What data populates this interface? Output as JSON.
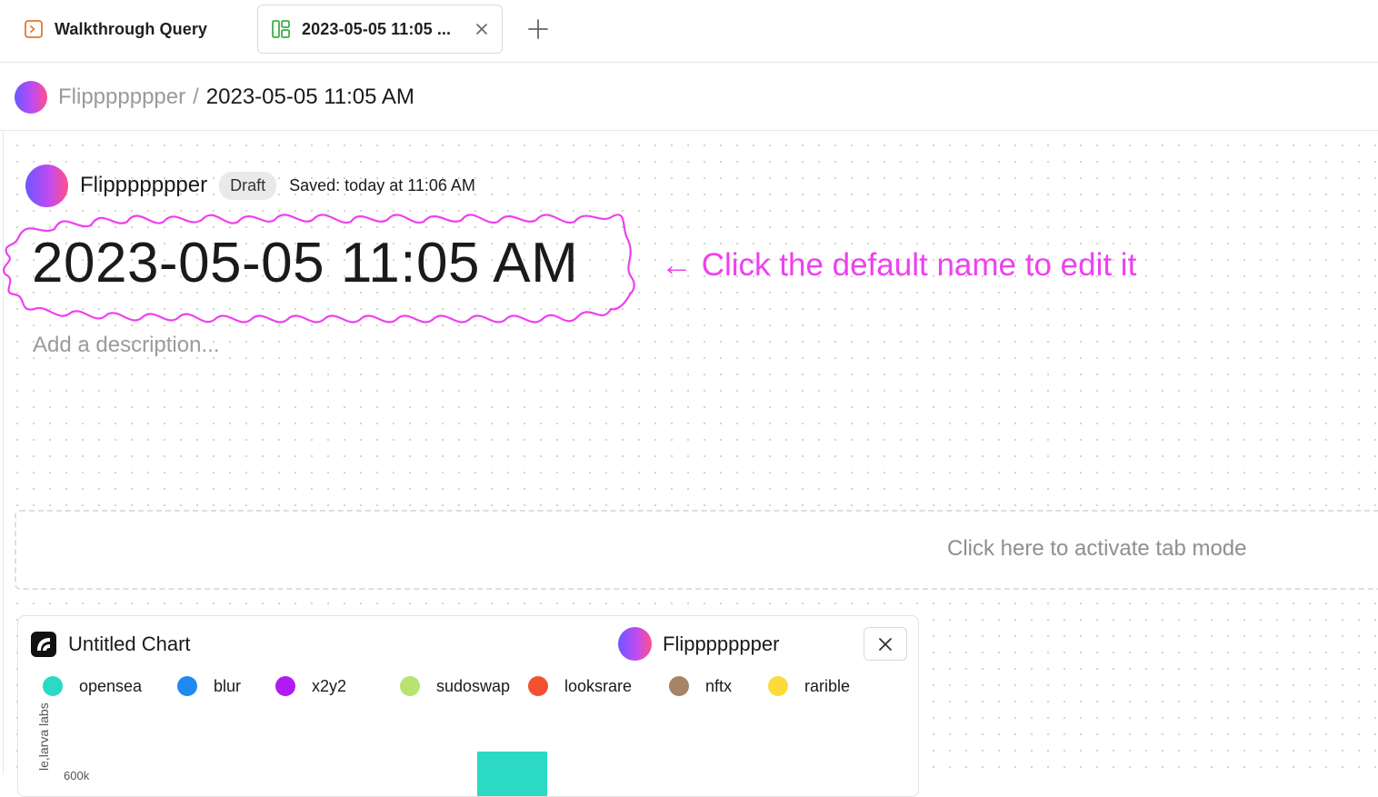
{
  "tabs": [
    {
      "label": "Walkthrough Query",
      "icon": "query-icon"
    },
    {
      "label": "2023-05-05 11:05 ...",
      "icon": "dashboard-icon",
      "active": true
    }
  ],
  "breadcrumb": {
    "owner": "Flippppppper",
    "separator": "/",
    "title": "2023-05-05 11:05 AM"
  },
  "dashboard": {
    "owner": "Flippppppper",
    "status_badge": "Draft",
    "saved_text": "Saved: today at 11:06 AM",
    "title": "2023-05-05 11:05 AM",
    "description_placeholder": "Add a description...",
    "annotation": "← Click the default name to edit it",
    "tab_mode_prompt": "Click here to activate tab mode"
  },
  "chart_card": {
    "title": "Untitled Chart",
    "owner": "Flippppppper"
  },
  "chart_data": {
    "type": "bar",
    "title": "Untitled Chart",
    "series": [
      {
        "name": "opensea",
        "color": "#2bd9c5"
      },
      {
        "name": "blur",
        "color": "#1f8bf2"
      },
      {
        "name": "x2y2",
        "color": "#b11bf2"
      },
      {
        "name": "sudoswap",
        "color": "#b7e36e"
      },
      {
        "name": "looksrare",
        "color": "#f25230"
      },
      {
        "name": "nftx",
        "color": "#a88466"
      },
      {
        "name": "rarible",
        "color": "#fadb3a"
      }
    ],
    "ylabel": "le,larva labs",
    "y_ticks": [
      "600k"
    ],
    "visible_bars": [
      {
        "series": "opensea",
        "value": 600000
      }
    ]
  }
}
